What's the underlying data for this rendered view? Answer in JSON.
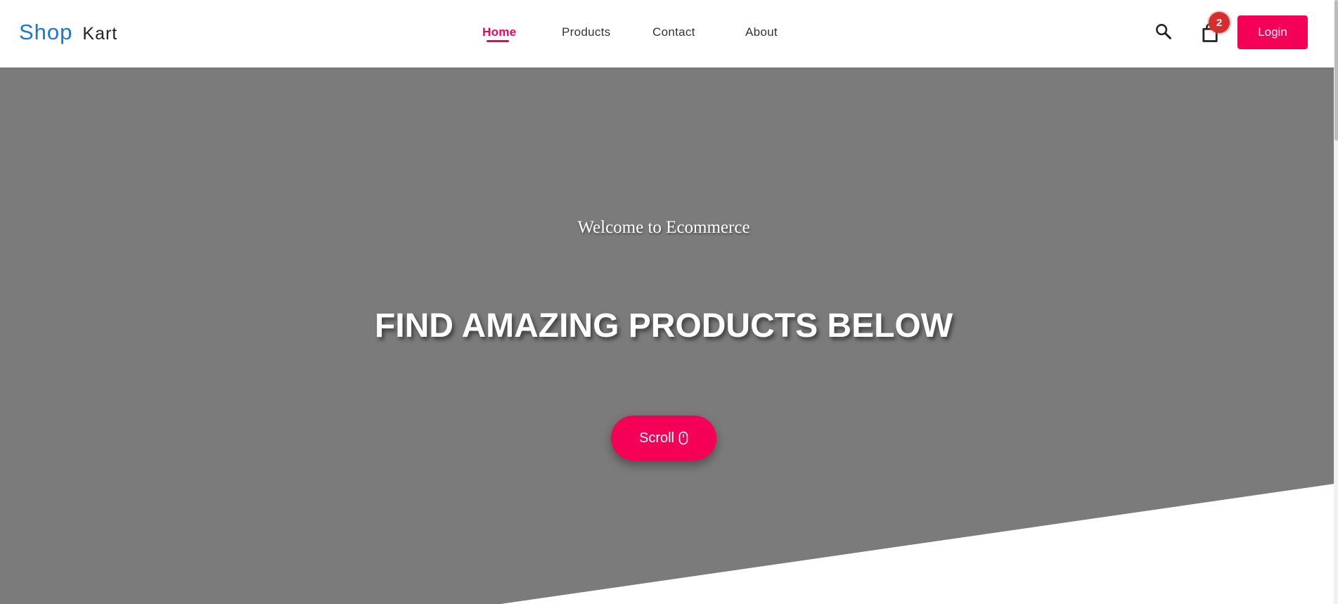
{
  "header": {
    "logo": {
      "part1": "Shop",
      "part2": "Kart"
    },
    "nav": [
      {
        "label": "Home",
        "active": true
      },
      {
        "label": "Products",
        "active": false
      },
      {
        "label": "Contact",
        "active": false
      },
      {
        "label": "About",
        "active": false
      }
    ],
    "search_icon": "search-icon",
    "cart_icon": "shopping-bag-icon",
    "cart_count": "2",
    "login_label": "Login"
  },
  "hero": {
    "welcome": "Welcome to Ecommerce",
    "headline": "FIND AMAZING PRODUCTS BELOW",
    "scroll_label": "Scroll",
    "scroll_icon": "mouse-icon"
  },
  "colors": {
    "accent": "#f50057",
    "brand_blue": "#1976d2",
    "hero_bg": "#7b7b7b",
    "badge": "#d32f2f"
  }
}
